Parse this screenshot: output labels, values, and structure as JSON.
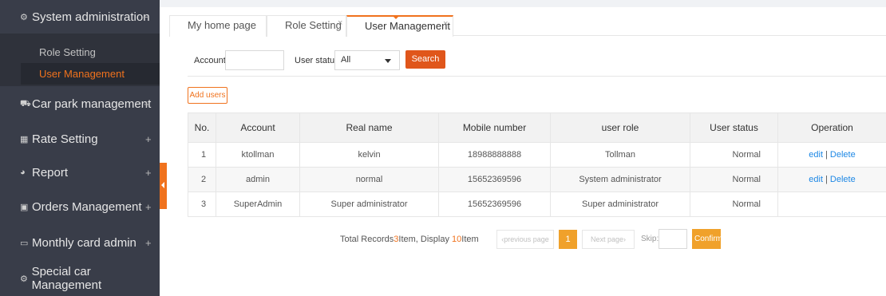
{
  "sidebar": {
    "menus": [
      {
        "glyph": "⚙",
        "label": "System administration",
        "sign": "−"
      },
      {
        "glyph": "⛟",
        "label": "Car park management",
        "sign": "+"
      },
      {
        "glyph": "▦",
        "label": "Rate Setting",
        "sign": "+"
      },
      {
        "glyph": "◕",
        "label": "Report",
        "sign": "+"
      },
      {
        "glyph": "▣",
        "label": "Orders Management",
        "sign": "+"
      },
      {
        "glyph": "▭",
        "label": "Monthly card admin",
        "sign": "+"
      },
      {
        "glyph": "⚙",
        "label": "Special car Management",
        "sign": ""
      }
    ],
    "submenu": [
      {
        "label": "Role Setting"
      },
      {
        "label": "User Management"
      }
    ]
  },
  "tabs": [
    {
      "label": "My home page",
      "close": ""
    },
    {
      "label": "Role Setting",
      "close": "×"
    },
    {
      "label": "User Management",
      "close": "×"
    }
  ],
  "filter": {
    "account_label": "Account:",
    "account_value": "",
    "status_label": "User status:",
    "status_selected": "All",
    "search_label": "Search"
  },
  "add_button": "Add users",
  "table": {
    "headers": [
      "No.",
      "Account",
      "Real name",
      "Mobile number",
      "user role",
      "User status",
      "Operation"
    ],
    "rows": [
      {
        "no": "1",
        "account": "ktollman",
        "real_name": "kelvin",
        "mobile": "18988888888",
        "role": "Tollman",
        "status": "Normal",
        "edit": "edit",
        "sep": "|",
        "delete": "Delete"
      },
      {
        "no": "2",
        "account": "admin",
        "real_name": "normal",
        "mobile": "15652369596",
        "role": "System administrator",
        "status": "Normal",
        "edit": "edit",
        "sep": "|",
        "delete": "Delete"
      },
      {
        "no": "3",
        "account": "SuperAdmin",
        "real_name": "Super administrator",
        "mobile": "15652369596",
        "role": "Super administrator",
        "status": "Normal",
        "edit": "",
        "sep": "",
        "delete": ""
      }
    ]
  },
  "pagination": {
    "total_prefix": "Total Records",
    "total_count": "3",
    "total_unit": "Item,",
    "display_prefix": "Display",
    "display_count": "10",
    "display_unit": "Item",
    "prev": "‹previous page",
    "current": "1",
    "next": "Next page›",
    "skip_label": "Skip:",
    "skip_value": "",
    "confirm": "Confirm"
  },
  "colors": {
    "accent": "#f0721d",
    "sidebar": "#393d49",
    "submenu": "#2f323b",
    "link": "#1e88e5",
    "pager": "#f0a12b"
  }
}
